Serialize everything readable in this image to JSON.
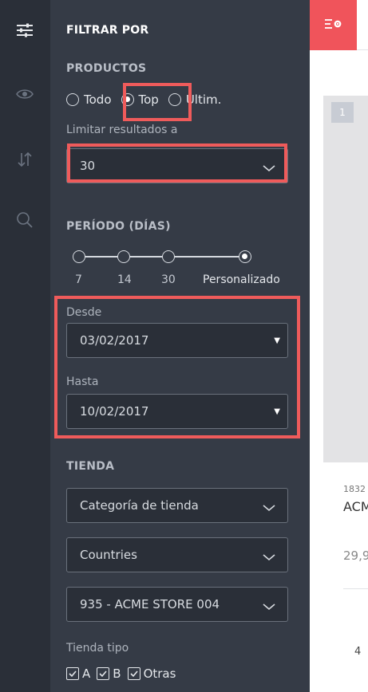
{
  "rail": {
    "icons": [
      "filter-sliders-icon",
      "eye-icon",
      "sort-arrows-icon",
      "search-icon"
    ]
  },
  "panel": {
    "title": "FILTRAR POR",
    "productos": {
      "title": "PRODUCTOS",
      "options": [
        "Todo",
        "Top",
        "Últim."
      ],
      "selected": "Top",
      "limit_label": "Limitar resultados a",
      "limit_value": "30"
    },
    "periodo": {
      "title": "PERÍODO (DÍAS)",
      "stops": [
        "7",
        "14",
        "30",
        "Personalizado"
      ],
      "selected": "Personalizado",
      "desde_label": "Desde",
      "desde_value": "03/02/2017",
      "hasta_label": "Hasta",
      "hasta_value": "10/02/2017"
    },
    "tienda": {
      "title": "TIENDA",
      "category_placeholder": "Categoría de tienda",
      "countries_placeholder": "Countries",
      "store_value": "935 - ACME STORE 004",
      "tipo_label": "Tienda tipo",
      "tipos": [
        {
          "label": "A",
          "checked": true
        },
        {
          "label": "B",
          "checked": true
        },
        {
          "label": "Otras",
          "checked": true
        }
      ]
    }
  },
  "content": {
    "card_rank": "1",
    "card_id": "1832",
    "card_name": "ACM",
    "card_price": "29,9",
    "row_number": "4"
  },
  "colors": {
    "rail_bg": "#2a2f38",
    "panel_bg": "#353b46",
    "accent_red": "#f0545b",
    "highlight": "#ef5b5b"
  }
}
